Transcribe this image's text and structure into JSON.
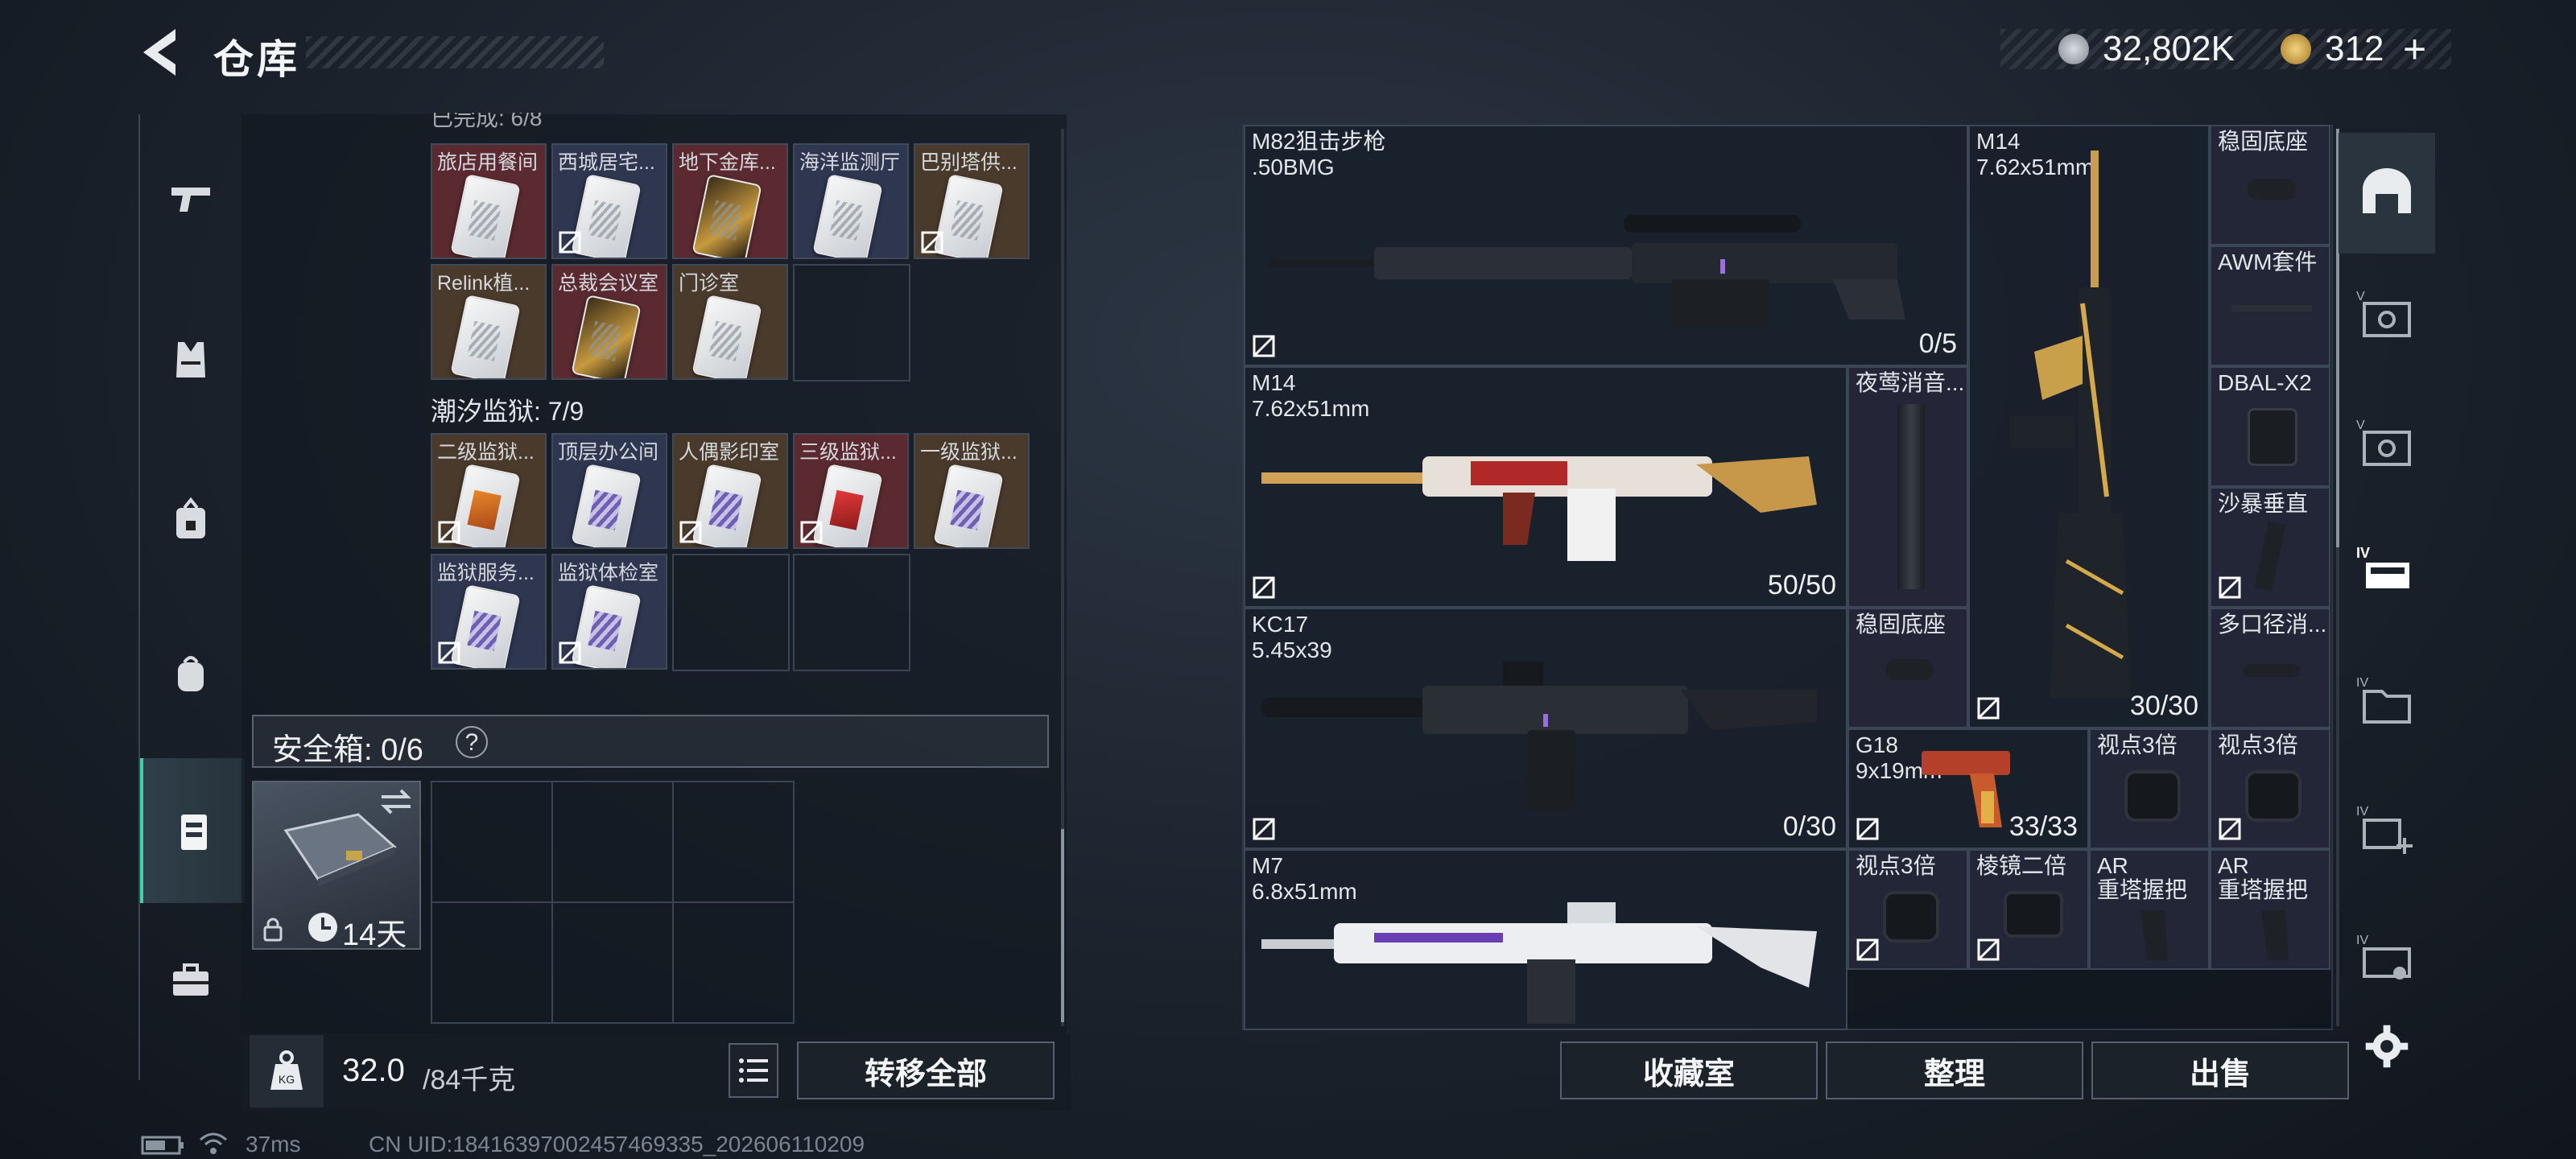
{
  "header": {
    "title": "仓库",
    "currency1": "32,802K",
    "currency2": "312",
    "plus": "+"
  },
  "sidebar": {
    "items": [
      {
        "icon": "pistol-icon"
      },
      {
        "icon": "vest-icon"
      },
      {
        "icon": "chest-rig-icon"
      },
      {
        "icon": "backpack-icon"
      },
      {
        "icon": "safe-box-icon",
        "active": true
      },
      {
        "icon": "toolbox-icon"
      }
    ]
  },
  "storage": {
    "top_partial_title": "已完成: 6/8",
    "row1": [
      {
        "label": "旅店用餐间",
        "tint": "red",
        "card": "white",
        "nolink": false
      },
      {
        "label": "西城居宅...",
        "tint": "blue",
        "card": "white",
        "nolink": true
      },
      {
        "label": "地下金库...",
        "tint": "red",
        "card": "gold",
        "nolink": false
      },
      {
        "label": "海洋监测厅",
        "tint": "blue",
        "card": "white",
        "nolink": false
      },
      {
        "label": "巴别塔供...",
        "tint": "brown",
        "card": "white",
        "nolink": true
      }
    ],
    "row2": [
      {
        "label": "Relink植...",
        "tint": "brown",
        "card": "white",
        "nolink": false
      },
      {
        "label": "总裁会议室",
        "tint": "red",
        "card": "gold",
        "nolink": false
      },
      {
        "label": "门诊室",
        "tint": "brown",
        "card": "white",
        "nolink": false
      }
    ],
    "prison_title": "潮汐监狱: 7/9",
    "row3": [
      {
        "label": "二级监狱...",
        "tint": "brown",
        "card": "orange",
        "nolink": true
      },
      {
        "label": "顶层办公间",
        "tint": "blue",
        "card": "purple",
        "nolink": false
      },
      {
        "label": "人偶影印室",
        "tint": "brown",
        "card": "purple",
        "nolink": true
      },
      {
        "label": "三级监狱...",
        "tint": "red",
        "card": "red",
        "nolink": true
      },
      {
        "label": "一级监狱...",
        "tint": "brown",
        "card": "purple",
        "nolink": false
      }
    ],
    "row4": [
      {
        "label": "监狱服务...",
        "tint": "blue",
        "card": "purple",
        "nolink": true
      },
      {
        "label": "监狱体检室",
        "tint": "blue",
        "card": "purple",
        "nolink": true
      }
    ]
  },
  "safe": {
    "label": "安全箱: 0/6",
    "help": "?",
    "case_days": "14天"
  },
  "footer": {
    "weight_current": "32.0",
    "weight_max": "/84千克",
    "transfer_all": "转移全部",
    "collection": "收藏室",
    "sort": "整理",
    "sell": "出售"
  },
  "weapons": {
    "m82": {
      "name": "M82狙击步枪",
      "ammo": ".50BMG",
      "count": "0/5"
    },
    "m14a": {
      "name": "M14",
      "ammo": "7.62x51mm",
      "count": "50/50"
    },
    "kc17": {
      "name": "KC17",
      "ammo": "5.45x39",
      "count": "0/30"
    },
    "m7": {
      "name": "M7",
      "ammo": "6.8x51mm"
    },
    "m14b": {
      "name": "M14",
      "ammo": "7.62x51mm",
      "count": "30/30"
    },
    "g18": {
      "name": "G18",
      "ammo": "9x19mm",
      "count": "33/33"
    }
  },
  "attachments": {
    "stock1": "稳固底座",
    "awm": "AWM套件",
    "dbal": "DBAL-X2",
    "desert": "沙暴垂直",
    "multi": "多口径消...",
    "night": "夜莺消音...",
    "stock2": "稳固底座",
    "scope3a": "视点3倍",
    "scope3b": "视点3倍",
    "scope3c": "视点3倍",
    "prism2": "棱镜二倍",
    "ar1_a": "AR",
    "ar1_b": "重塔握把",
    "ar2_a": "AR",
    "ar2_b": "重塔握把"
  },
  "status": {
    "ping": "37ms",
    "uid": "CN UID:18416397002457469335_202606110209"
  },
  "colors": {
    "accent": "#3fd3a7",
    "tint_red": "#5a2a30",
    "tint_blue": "#2e3650",
    "tint_brown": "#4a3a2c"
  }
}
